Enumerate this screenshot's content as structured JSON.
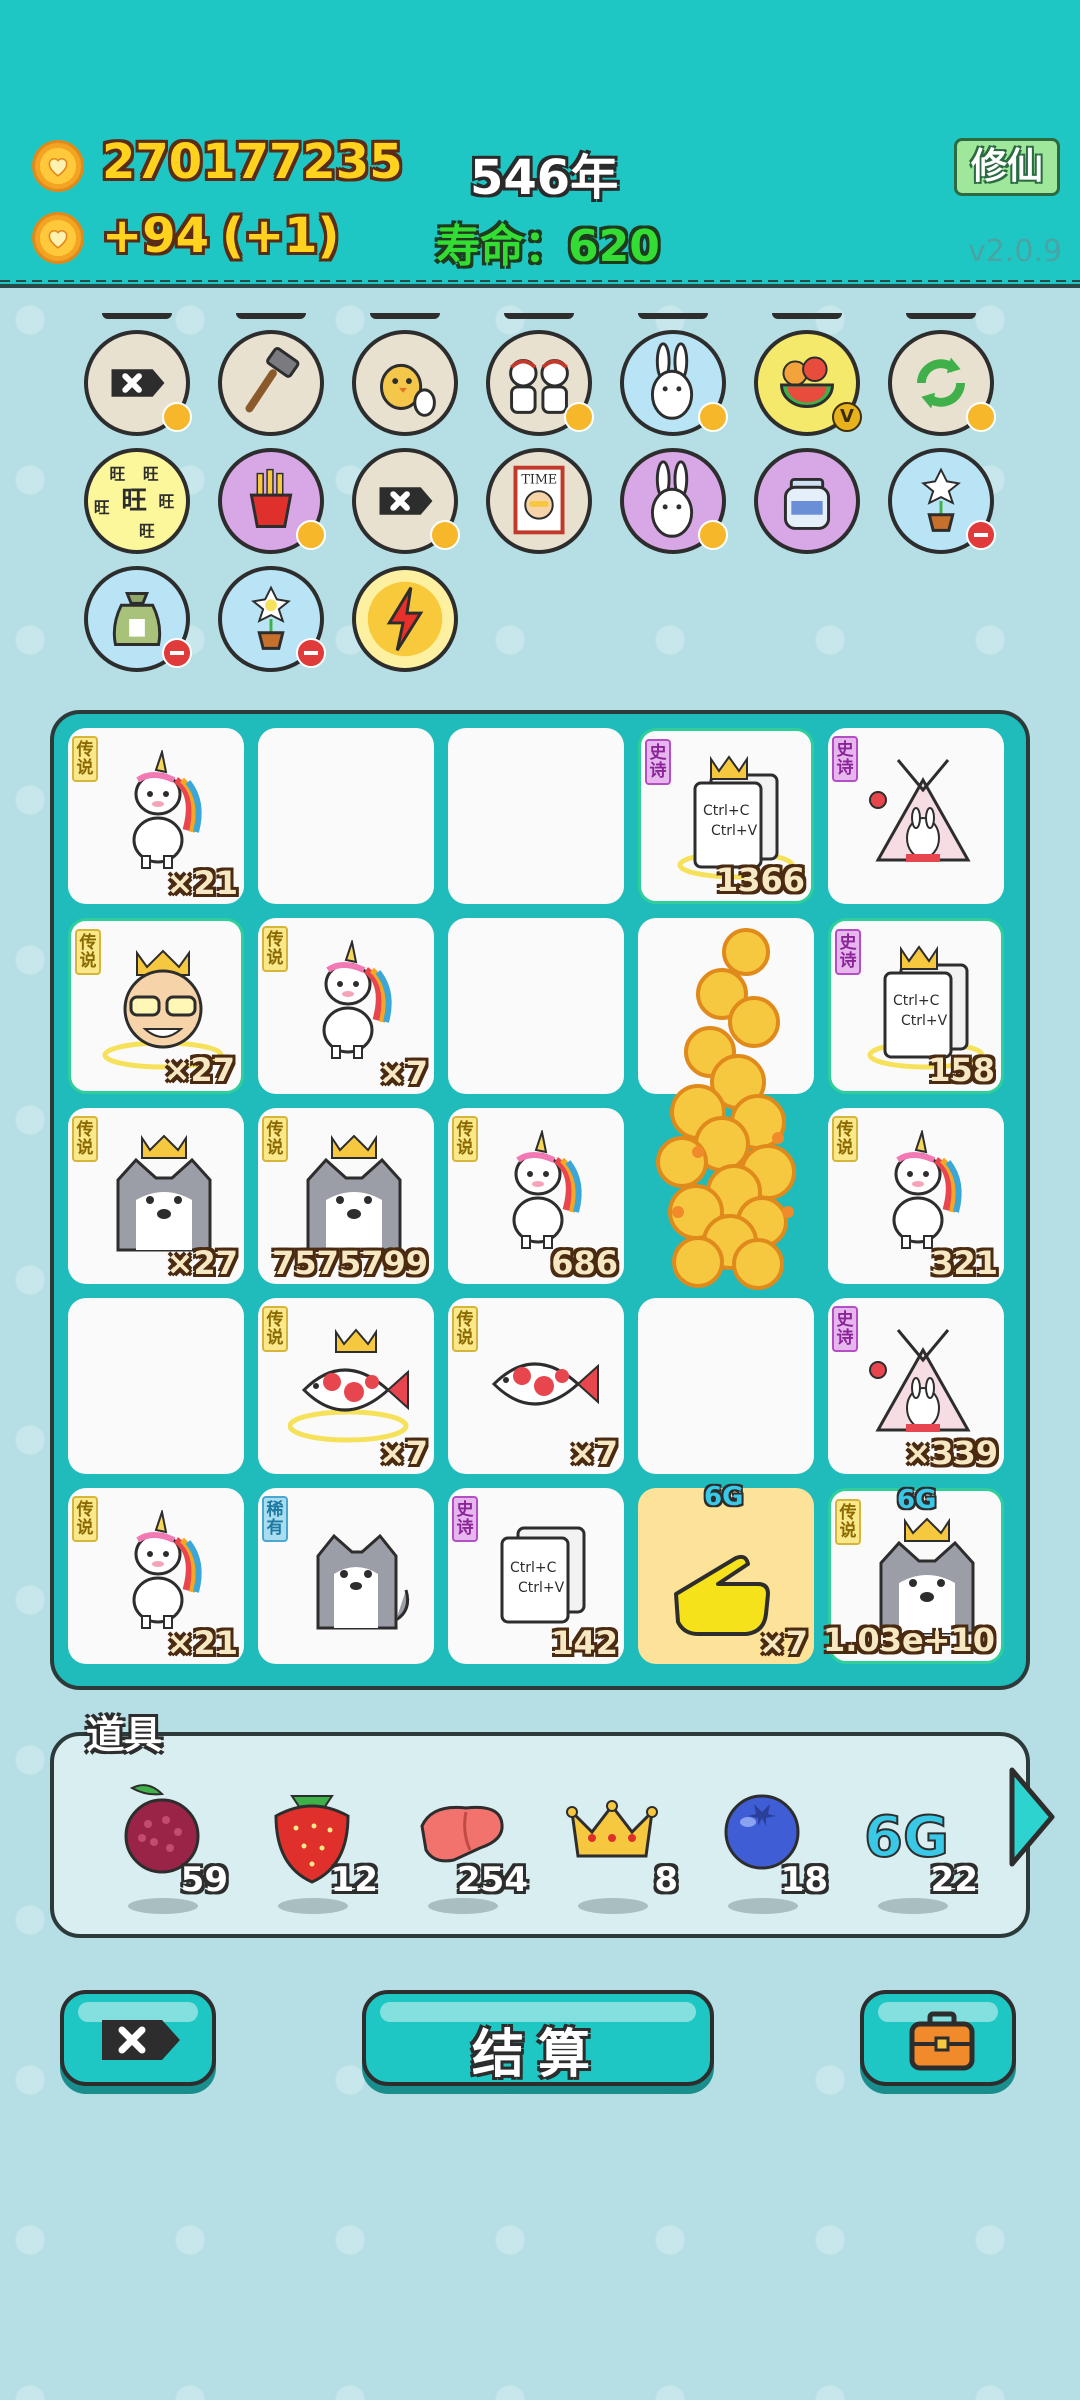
{
  "header": {
    "coins": "270177235",
    "income": "+94",
    "income_bonus": "(+1)",
    "year": "546年",
    "life_label": "寿命：",
    "life_value": "620",
    "xiuxian_label": "修仙",
    "version": "v2.0.9"
  },
  "skills": [
    {
      "icon": "cross-tag-icon",
      "badge": "heart"
    },
    {
      "icon": "hammer-icon",
      "badge": ""
    },
    {
      "icon": "chick-egg-icon",
      "badge": ""
    },
    {
      "icon": "two-figures-icon",
      "badge": "heart"
    },
    {
      "icon": "rabbit-icon",
      "badge": "heart"
    },
    {
      "icon": "fruit-bowl-icon",
      "badge": "v"
    },
    {
      "icon": "refresh-icon",
      "badge": "heart"
    },
    {
      "icon": "wang-text-icon",
      "badge": "",
      "text": [
        "旺",
        "旺",
        "旺",
        "旺",
        "旺",
        "旺"
      ]
    },
    {
      "icon": "fries-icon",
      "badge": "heart"
    },
    {
      "icon": "cross-tag-icon",
      "badge": "heart"
    },
    {
      "icon": "time-magazine-icon",
      "badge": "",
      "text": [
        "TIME"
      ]
    },
    {
      "icon": "rabbit-icon",
      "badge": "heart"
    },
    {
      "icon": "jar-icon",
      "badge": ""
    },
    {
      "icon": "flower-pot-icon",
      "badge": "minus"
    },
    {
      "icon": "money-bag-icon",
      "badge": "minus"
    },
    {
      "icon": "flower-pot-icon",
      "badge": "minus"
    },
    {
      "icon": "lightning-icon",
      "badge": ""
    }
  ],
  "board": {
    "cells": [
      {
        "tag": "传说",
        "tier": "legend",
        "icon": "unicorn-icon",
        "count": "×21",
        "hl": false
      },
      {
        "tag": "",
        "tier": "",
        "icon": "",
        "count": "",
        "hl": false
      },
      {
        "tag": "",
        "tier": "",
        "icon": "",
        "count": "",
        "hl": false
      },
      {
        "tag": "史诗",
        "tier": "epic",
        "icon": "ctrl-cv-crown-icon",
        "count": "1366",
        "hl": true,
        "art_text": [
          "Ctrl+C",
          "Ctrl+V"
        ]
      },
      {
        "tag": "史诗",
        "tier": "epic",
        "icon": "rabbit-tent-icon",
        "count": "",
        "hl": false
      },
      {
        "tag": "传说",
        "tier": "legend",
        "icon": "crowned-old-man-icon",
        "count": "×27",
        "hl": true
      },
      {
        "tag": "传说",
        "tier": "legend",
        "icon": "unicorn-icon",
        "count": "×7",
        "hl": false
      },
      {
        "tag": "",
        "tier": "",
        "icon": "",
        "count": "",
        "hl": false
      },
      {
        "tag": "",
        "tier": "",
        "icon": "",
        "count": "",
        "hl": false
      },
      {
        "tag": "史诗",
        "tier": "epic",
        "icon": "ctrl-cv-crown-icon",
        "count": "158",
        "hl": true,
        "art_text": [
          "Ctrl+C",
          "Ctrl+V"
        ]
      },
      {
        "tag": "传说",
        "tier": "legend",
        "icon": "crowned-husky-icon",
        "count": "×27",
        "hl": false
      },
      {
        "tag": "传说",
        "tier": "legend",
        "icon": "crowned-husky-icon",
        "count": "7575799",
        "hl": false
      },
      {
        "tag": "传说",
        "tier": "legend",
        "icon": "unicorn-icon",
        "count": "686",
        "hl": false
      },
      {
        "tag": "",
        "tier": "",
        "icon": "coin-pile-icon",
        "count": "",
        "hl": false
      },
      {
        "tag": "传说",
        "tier": "legend",
        "icon": "unicorn-icon",
        "count": "321",
        "hl": false
      },
      {
        "tag": "",
        "tier": "",
        "icon": "",
        "count": "",
        "hl": false
      },
      {
        "tag": "传说",
        "tier": "legend",
        "icon": "crowned-koi-icon",
        "count": "×7",
        "hl": false
      },
      {
        "tag": "传说",
        "tier": "legend",
        "icon": "koi-fish-icon",
        "count": "×7",
        "hl": false
      },
      {
        "tag": "",
        "tier": "",
        "icon": "",
        "count": "",
        "hl": false
      },
      {
        "tag": "史诗",
        "tier": "epic",
        "icon": "rabbit-tent-icon",
        "count": "×339",
        "hl": false
      },
      {
        "tag": "传说",
        "tier": "legend",
        "icon": "unicorn-icon",
        "count": "×21",
        "hl": false
      },
      {
        "tag": "稀有",
        "tier": "rare",
        "icon": "husky-icon",
        "count": "",
        "hl": false
      },
      {
        "tag": "史诗",
        "tier": "epic",
        "icon": "ctrl-cv-icon",
        "count": "142",
        "hl": false,
        "art_text": [
          "Ctrl+C",
          "Ctrl+V"
        ]
      },
      {
        "tag": "",
        "tier": "",
        "icon": "pointing-hand-icon",
        "count": "×7",
        "hl": false,
        "g_label": "6G",
        "bg": "#fde29a"
      },
      {
        "tag": "传说",
        "tier": "legend",
        "icon": "crowned-husky-icon",
        "count": "1.03e+10",
        "hl": true,
        "g_label": "6G"
      }
    ]
  },
  "props": {
    "title": "道具",
    "items": [
      {
        "icon": "lychee-icon",
        "count": "59"
      },
      {
        "icon": "strawberry-icon",
        "count": "12"
      },
      {
        "icon": "liver-icon",
        "count": "254"
      },
      {
        "icon": "crown-icon",
        "count": "8"
      },
      {
        "icon": "blueberry-icon",
        "count": "18"
      },
      {
        "icon": "6g-icon",
        "count": "22",
        "text": "6G"
      }
    ]
  },
  "buttons": {
    "settle_label": "结算"
  },
  "colors": {
    "teal": "#1ec7c4",
    "legend": "#fbe88a",
    "epic": "#e7b6ef",
    "rare": "#a9ddf0",
    "coin": "#ffc93b"
  }
}
